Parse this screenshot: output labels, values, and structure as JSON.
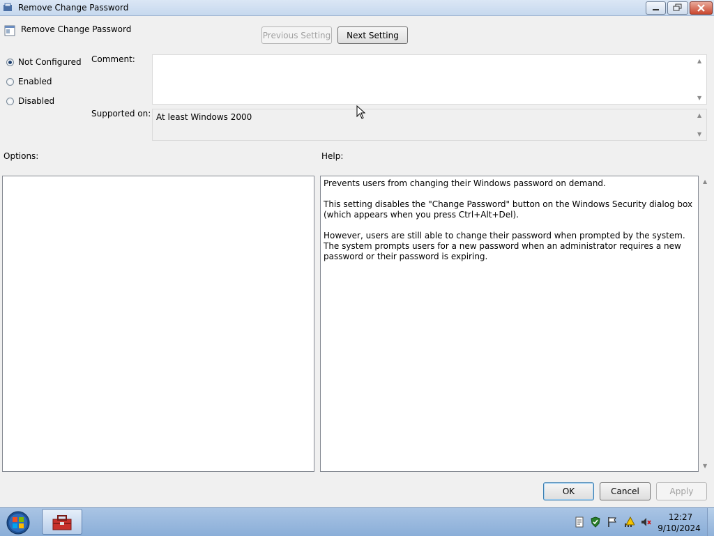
{
  "window": {
    "title": "Remove Change Password",
    "controls": {
      "minimize": "minimize",
      "maximize": "maximize",
      "close": "close"
    }
  },
  "header": {
    "policy_name": "Remove Change Password",
    "previous_setting": "Previous Setting",
    "next_setting": "Next Setting"
  },
  "state": {
    "options": [
      {
        "label": "Not Configured",
        "selected": true
      },
      {
        "label": "Enabled",
        "selected": false
      },
      {
        "label": "Disabled",
        "selected": false
      }
    ]
  },
  "comment": {
    "label": "Comment:",
    "value": ""
  },
  "supported": {
    "label": "Supported on:",
    "value": "At least Windows 2000"
  },
  "options_panel": {
    "label": "Options:"
  },
  "help_panel": {
    "label": "Help:",
    "paragraphs": [
      "Prevents users from changing their Windows password on demand.",
      "This setting disables the \"Change Password\" button on the Windows Security dialog box (which appears when you press Ctrl+Alt+Del).",
      "However, users are still able to change their password when prompted by the system. The system prompts users for a new password when an administrator requires a new password or their password is expiring."
    ]
  },
  "buttons": {
    "ok": "OK",
    "cancel": "Cancel",
    "apply": "Apply"
  },
  "taskbar": {
    "clock_time": "12:27",
    "clock_date": "9/10/2024",
    "tray_icons": [
      "document-icon",
      "security-shield-icon",
      "action-center-flag-icon",
      "network-icon",
      "volume-muted-icon"
    ]
  },
  "colors": {
    "accent": "#3c7fb1",
    "taskbar": "#a9c4e4",
    "close": "#c9472f"
  }
}
